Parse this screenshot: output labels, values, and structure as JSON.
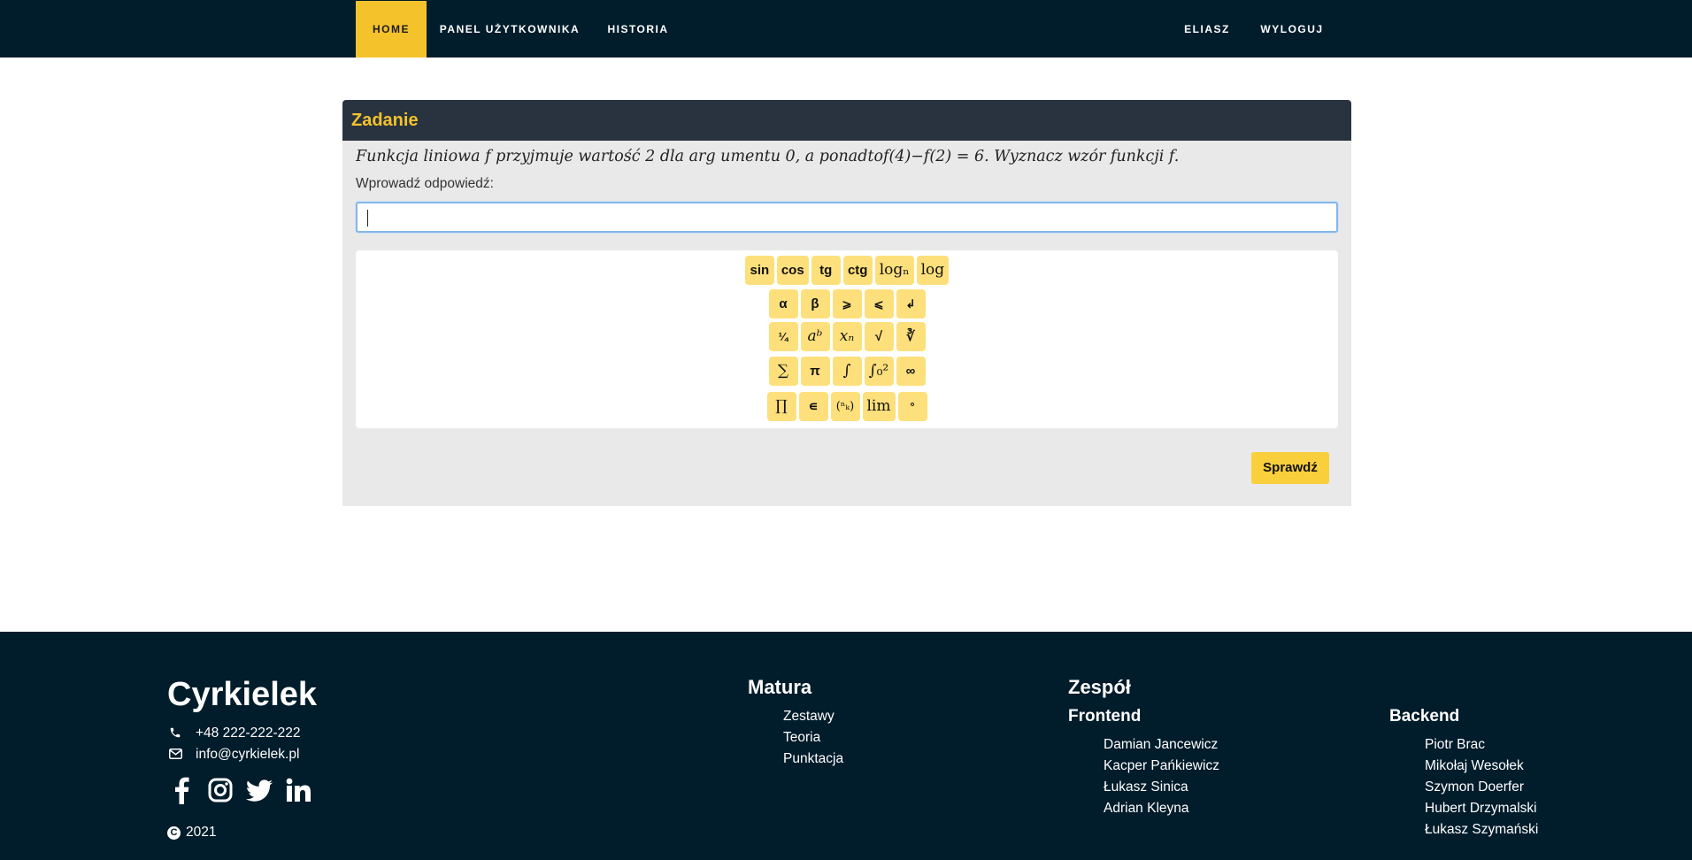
{
  "nav": {
    "home": "HOME",
    "panel": "PANEL UŻYTKOWNIKA",
    "history": "HISTORIA",
    "user": "ELIASZ",
    "logout": "WYLOGUJ"
  },
  "task": {
    "header": "Zadanie",
    "text": "Funkcja liniowa f przyjmuje wartość 2 dla arg umentu 0, a ponadtof(4)−f(2) = 6. Wyznacz wzór funkcji f.",
    "answer_label": "Wprowadź odpowiedź:",
    "answer_value": "",
    "check_button": "Sprawdź"
  },
  "keyboard": {
    "row1": [
      "sin",
      "cos",
      "tg",
      "ctg",
      "logₙ",
      "log"
    ],
    "row2": [
      "α",
      "β",
      "⩾",
      "⩽",
      "↲"
    ],
    "row3": [
      "¼",
      "aᵇ",
      "xₙ",
      "√",
      "∛"
    ],
    "row4": [
      "∑",
      "π",
      "∫",
      "∫₀²",
      "∞"
    ],
    "row5": [
      "∏",
      "∊",
      "(ⁿₖ)",
      "lim",
      "°"
    ]
  },
  "footer": {
    "brand": "Cyrkielek",
    "phone": "+48 222-222-222",
    "email": "info@cyrkielek.pl",
    "copyright": "2021",
    "matura": {
      "title": "Matura",
      "links": [
        "Zestawy",
        "Teoria",
        "Punktacja"
      ]
    },
    "team": {
      "title": "Zespół",
      "frontend_title": "Frontend",
      "frontend": [
        "Damian Jancewicz",
        "Kacper Pańkiewicz",
        "Łukasz Sinica",
        "Adrian Kleyna"
      ],
      "backend_title": "Backend",
      "backend": [
        "Piotr Brac",
        "Mikołaj Wesołek",
        "Szymon Doerfer",
        "Hubert Drzymalski",
        "Łukasz Szymański"
      ]
    }
  },
  "colors": {
    "navbar": "#011c2b",
    "accent": "#f4c22b",
    "key": "#fde07b",
    "card_header": "#293340"
  },
  "icons": [
    "phone-icon",
    "envelope-icon",
    "facebook-icon",
    "instagram-icon",
    "twitter-icon",
    "linkedin-icon",
    "copyright-icon"
  ]
}
